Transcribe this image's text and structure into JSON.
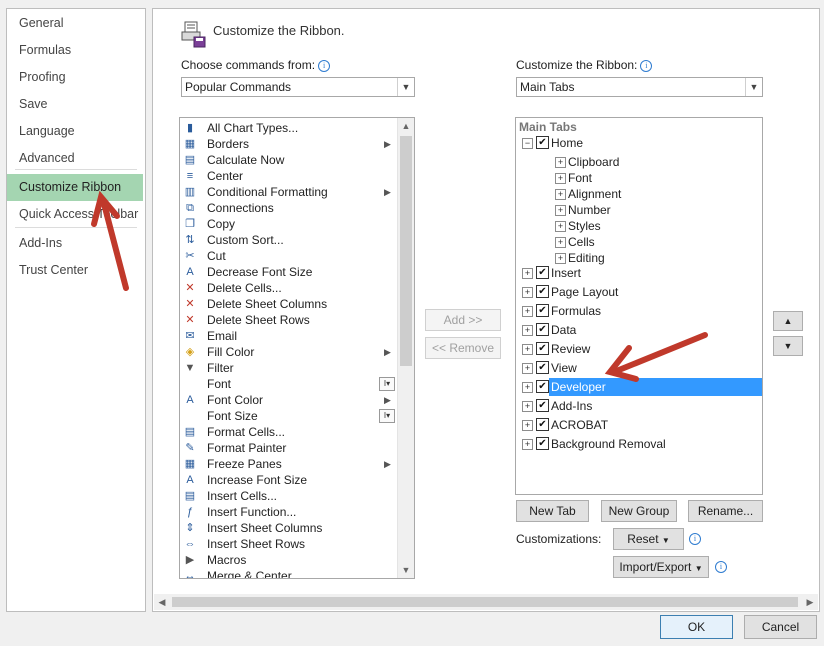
{
  "sidebar": {
    "items": [
      {
        "label": "General"
      },
      {
        "label": "Formulas"
      },
      {
        "label": "Proofing"
      },
      {
        "label": "Save"
      },
      {
        "label": "Language"
      },
      {
        "label": "Advanced"
      },
      {
        "label": "Customize Ribbon",
        "selected": true
      },
      {
        "label": "Quick Access Toolbar"
      },
      {
        "label": "Add-Ins"
      },
      {
        "label": "Trust Center"
      }
    ]
  },
  "header": {
    "title": "Customize the Ribbon."
  },
  "left": {
    "label": "Choose commands from:",
    "combo_value": "Popular Commands",
    "commands": [
      {
        "label": "All Chart Types...",
        "icon": "chart-icon"
      },
      {
        "label": "Borders",
        "icon": "borders-icon",
        "submenu": true
      },
      {
        "label": "Calculate Now",
        "icon": "calculator-icon"
      },
      {
        "label": "Center",
        "icon": "align-center-icon"
      },
      {
        "label": "Conditional Formatting",
        "icon": "conditional-formatting-icon",
        "submenu": true
      },
      {
        "label": "Connections",
        "icon": "connections-icon"
      },
      {
        "label": "Copy",
        "icon": "copy-icon"
      },
      {
        "label": "Custom Sort...",
        "icon": "sort-icon"
      },
      {
        "label": "Cut",
        "icon": "scissors-icon"
      },
      {
        "label": "Decrease Font Size",
        "icon": "decrease-font-icon"
      },
      {
        "label": "Delete Cells...",
        "icon": "delete-cells-icon"
      },
      {
        "label": "Delete Sheet Columns",
        "icon": "delete-columns-icon"
      },
      {
        "label": "Delete Sheet Rows",
        "icon": "delete-rows-icon"
      },
      {
        "label": "Email",
        "icon": "email-icon"
      },
      {
        "label": "Fill Color",
        "icon": "fill-color-icon",
        "submenu": true
      },
      {
        "label": "Filter",
        "icon": "filter-icon"
      },
      {
        "label": "Font",
        "icon": "",
        "split": true
      },
      {
        "label": "Font Color",
        "icon": "font-color-icon",
        "submenu": true
      },
      {
        "label": "Font Size",
        "icon": "",
        "split": true
      },
      {
        "label": "Format Cells...",
        "icon": "format-cells-icon"
      },
      {
        "label": "Format Painter",
        "icon": "format-painter-icon"
      },
      {
        "label": "Freeze Panes",
        "icon": "freeze-panes-icon",
        "submenu": true
      },
      {
        "label": "Increase Font Size",
        "icon": "increase-font-icon"
      },
      {
        "label": "Insert Cells...",
        "icon": "insert-cells-icon"
      },
      {
        "label": "Insert Function...",
        "icon": "function-icon"
      },
      {
        "label": "Insert Sheet Columns",
        "icon": "insert-columns-icon"
      },
      {
        "label": "Insert Sheet Rows",
        "icon": "insert-rows-icon"
      },
      {
        "label": "Macros",
        "icon": "macros-icon"
      },
      {
        "label": "Merge & Center",
        "icon": "merge-center-icon"
      }
    ]
  },
  "middle": {
    "add_label": "Add >>",
    "remove_label": "<< Remove"
  },
  "right": {
    "label": "Customize the Ribbon:",
    "combo_value": "Main Tabs",
    "header": "Main Tabs",
    "tree": [
      {
        "label": "Home",
        "level": 1,
        "expander": "minus",
        "checkbox": true
      },
      {
        "label": "Clipboard",
        "level": 2,
        "expander": "plus"
      },
      {
        "label": "Font",
        "level": 2,
        "expander": "plus"
      },
      {
        "label": "Alignment",
        "level": 2,
        "expander": "plus"
      },
      {
        "label": "Number",
        "level": 2,
        "expander": "plus"
      },
      {
        "label": "Styles",
        "level": 2,
        "expander": "plus"
      },
      {
        "label": "Cells",
        "level": 2,
        "expander": "plus"
      },
      {
        "label": "Editing",
        "level": 2,
        "expander": "plus"
      },
      {
        "label": "Insert",
        "level": 1,
        "expander": "plus",
        "checkbox": true
      },
      {
        "label": "Page Layout",
        "level": 1,
        "expander": "plus",
        "checkbox": true
      },
      {
        "label": "Formulas",
        "level": 1,
        "expander": "plus",
        "checkbox": true
      },
      {
        "label": "Data",
        "level": 1,
        "expander": "plus",
        "checkbox": true
      },
      {
        "label": "Review",
        "level": 1,
        "expander": "plus",
        "checkbox": true
      },
      {
        "label": "View",
        "level": 1,
        "expander": "plus",
        "checkbox": true
      },
      {
        "label": "Developer",
        "level": 1,
        "expander": "plus",
        "checkbox": true,
        "selected": true
      },
      {
        "label": "Add-Ins",
        "level": 1,
        "expander": "plus",
        "checkbox": true
      },
      {
        "label": "ACROBAT",
        "level": 1,
        "expander": "plus",
        "checkbox": true
      },
      {
        "label": "Background Removal",
        "level": 1,
        "expander": "plus",
        "checkbox": true
      }
    ],
    "new_tab_label": "New Tab",
    "new_group_label": "New Group",
    "rename_label": "Rename...",
    "customizations_label": "Customizations:",
    "reset_label": "Reset",
    "import_export_label": "Import/Export"
  },
  "footer": {
    "ok_label": "OK",
    "cancel_label": "Cancel"
  },
  "colors": {
    "selected_sidebar": "#a4d5b1",
    "selected_tree": "#3399ff",
    "annotation_arrow": "#c0392b"
  }
}
